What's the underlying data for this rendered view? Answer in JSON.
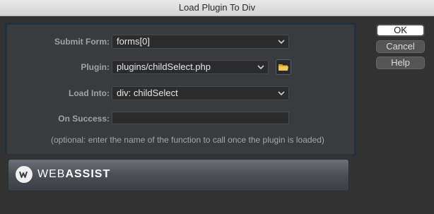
{
  "window": {
    "title": "Load Plugin To Div"
  },
  "form": {
    "submit_form": {
      "label": "Submit Form:",
      "value": "forms[0]"
    },
    "plugin": {
      "label": "Plugin:",
      "value": "plugins/childSelect.php"
    },
    "load_into": {
      "label": "Load Into:",
      "value": "div: childSelect"
    },
    "on_success": {
      "label": "On Success:",
      "value": ""
    },
    "hint": "(optional: enter the name of the function to call once the plugin is loaded)"
  },
  "banner": {
    "brand_light": "WEB",
    "brand_bold": "ASSIST"
  },
  "buttons": {
    "ok": "OK",
    "cancel": "Cancel",
    "help": "Help"
  },
  "icons": {
    "chevron": "chevron-down-icon",
    "folder": "folder-icon",
    "logo": "webassist-logo-icon"
  },
  "colors": {
    "panel_border": "#22303d",
    "ok_bg": "#ffffff",
    "folder_yellow": "#e8b84a"
  }
}
